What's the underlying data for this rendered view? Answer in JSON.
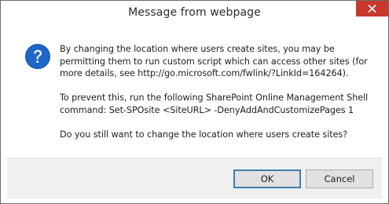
{
  "window": {
    "title": "Message from webpage",
    "close_icon": "close-x-icon",
    "accent_close": "#c7392c"
  },
  "message": {
    "icon": "question-icon",
    "icon_color": "#1e66c8",
    "paragraph1_lines": [
      "By changing the location where users create sites, you may be",
      "permitting them to run custom script which can access other sites (for",
      "more details, see http://go.microsoft.com/fwlink/?LinkId=164264)."
    ],
    "paragraph2_lines": [
      "To prevent this, run the following SharePoint Online Management Shell",
      "command: Set-SPOsite <SiteURL> -DenyAddAndCustomizePages 1"
    ],
    "paragraph3": "Do you still want to change the location where users create sites?"
  },
  "buttons": {
    "ok_label": "OK",
    "cancel_label": "Cancel"
  }
}
